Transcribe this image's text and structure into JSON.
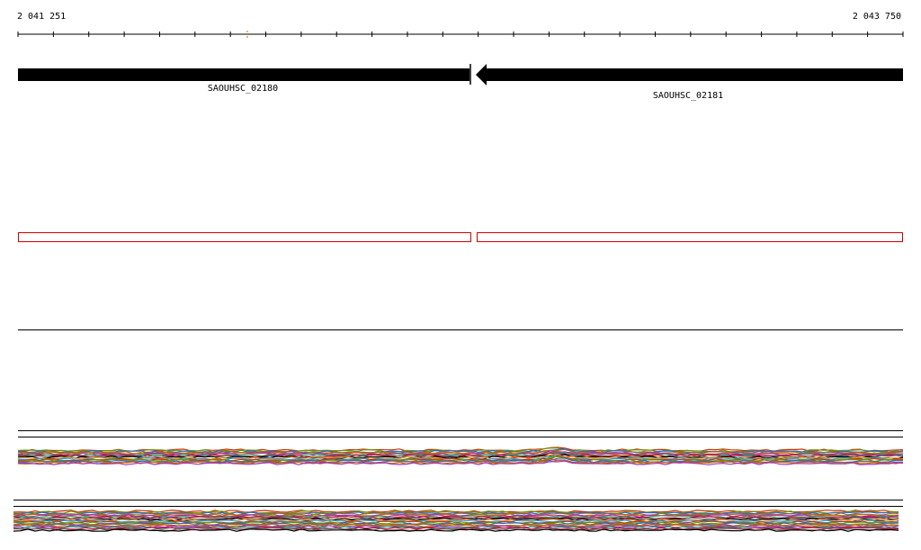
{
  "ruler": {
    "start_label": "2 041 251",
    "end_label": "2 043 750"
  },
  "genes": [
    {
      "name": "SAOUHSC_02180",
      "strand": "+"
    },
    {
      "name": "SAOUHSC_02181",
      "strand": "-"
    }
  ],
  "colors": {
    "gene": "#000000",
    "feature_outline": "#cc0000",
    "ruler_marker": "#cc6600"
  },
  "tracks": [
    {
      "kind": "gene-annotation"
    },
    {
      "kind": "feature-boxes"
    },
    {
      "kind": "empty-track"
    },
    {
      "kind": "coverage-lines-1"
    },
    {
      "kind": "coverage-lines-2"
    }
  ]
}
